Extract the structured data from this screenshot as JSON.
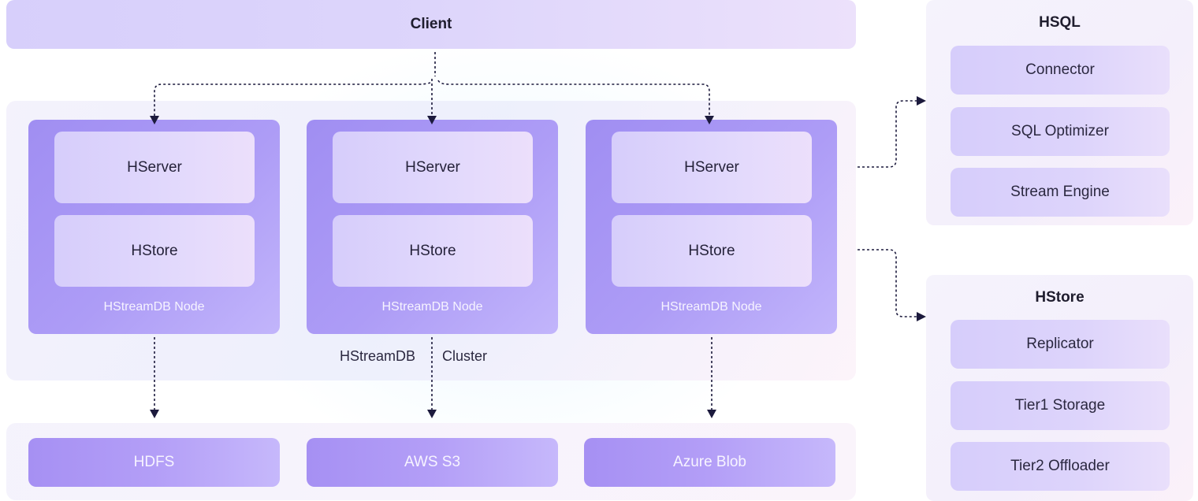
{
  "client": {
    "label": "Client"
  },
  "cluster": {
    "label_left": "HStreamDB",
    "label_right": "Cluster",
    "nodes": [
      {
        "server": "HServer",
        "store": "HStore",
        "label": "HStreamDB Node"
      },
      {
        "server": "HServer",
        "store": "HStore",
        "label": "HStreamDB Node"
      },
      {
        "server": "HServer",
        "store": "HStore",
        "label": "HStreamDB Node"
      }
    ]
  },
  "storage": [
    {
      "label": "HDFS"
    },
    {
      "label": "AWS S3"
    },
    {
      "label": "Azure Blob"
    }
  ],
  "hsql": {
    "title": "HSQL",
    "items": [
      "Connector",
      "SQL Optimizer",
      "Stream Engine"
    ]
  },
  "hstore": {
    "title": "HStore",
    "items": [
      "Replicator",
      "Tier1 Storage",
      "Tier2 Offloader"
    ]
  },
  "colors": {
    "arrow": "#1c1a3d",
    "node": "#a08ef2",
    "inner": "#d6cdfb"
  }
}
